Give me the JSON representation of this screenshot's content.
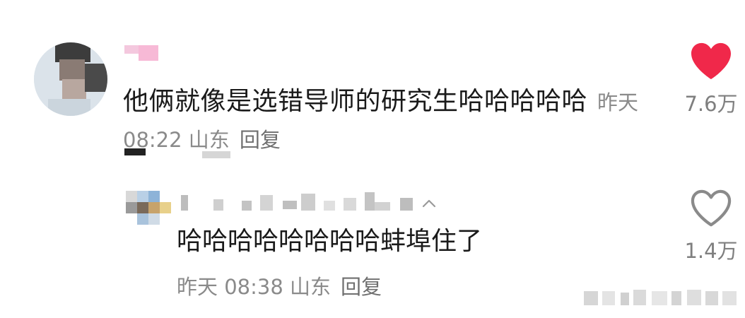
{
  "comment": {
    "text": "他俩就像是选错导师的研究生哈哈哈哈哈",
    "time": "昨天 08:22",
    "location": "山东",
    "reply_label": "回复",
    "like_count": "7.6万",
    "liked": true
  },
  "reply": {
    "text": "哈哈哈哈哈哈哈哈蚌埠住了",
    "time": "昨天 08:38",
    "location": "山东",
    "reply_label": "回复",
    "like_count": "1.4万",
    "liked": false
  },
  "colors": {
    "heart_filled": "#f0284a",
    "heart_outline": "#8a8a8a",
    "meta_text": "#8a8a8a",
    "body_text": "#1a1a1a"
  },
  "icons": {
    "like_filled": "heart-filled-icon",
    "like_outline": "heart-outline-icon",
    "expand": "chevron-up-icon"
  }
}
